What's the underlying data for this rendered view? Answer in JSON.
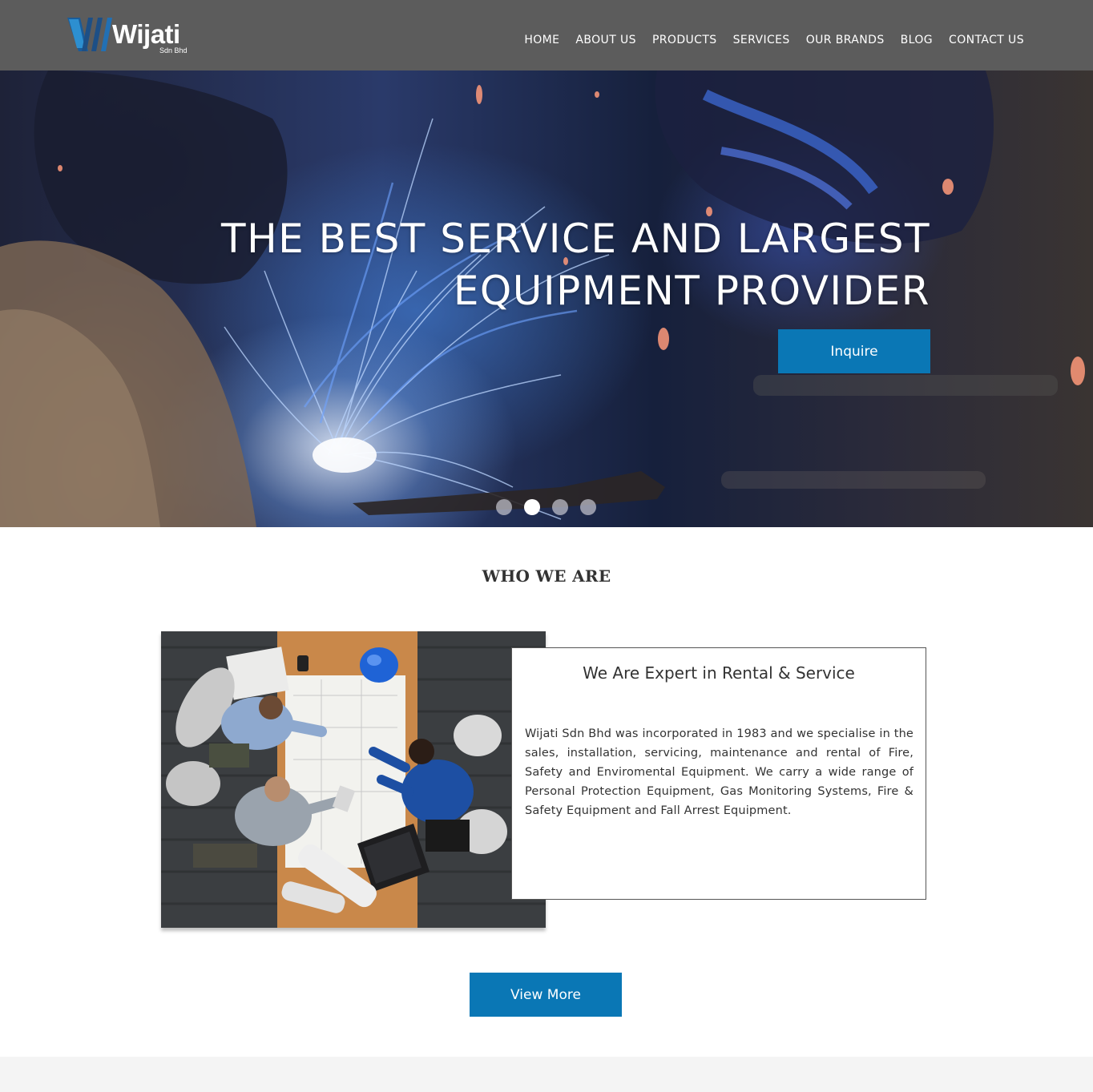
{
  "header": {
    "logo_text": "Wijati",
    "logo_sub": "Sdn Bhd",
    "nav": [
      {
        "label": "HOME"
      },
      {
        "label": "ABOUT US"
      },
      {
        "label": "PRODUCTS"
      },
      {
        "label": "SERVICES"
      },
      {
        "label": "OUR BRANDS"
      },
      {
        "label": "BLOG"
      },
      {
        "label": "CONTACT US"
      }
    ]
  },
  "hero": {
    "title_line1": "THE BEST SERVICE AND LARGEST",
    "title_line2": "EQUIPMENT PROVIDER",
    "button_label": "Inquire",
    "slide_count": 4,
    "active_slide": 2
  },
  "about": {
    "section_title": "WHO WE ARE",
    "card_title": "We Are Expert in Rental & Service",
    "card_text": "Wijati Sdn Bhd was incorporated in 1983 and we specialise in the sales, installation, servicing, maintenance and rental of Fire, Safety and Enviromental Equipment. We carry a wide range of Personal Protection Equipment, Gas Monitoring Systems, Fire & Safety Equipment and Fall Arrest Equipment.",
    "button_label": "View More"
  },
  "colors": {
    "header_bg": "#5c5c5c",
    "accent": "#0a77b5",
    "footer_bg": "#f4f4f4"
  }
}
